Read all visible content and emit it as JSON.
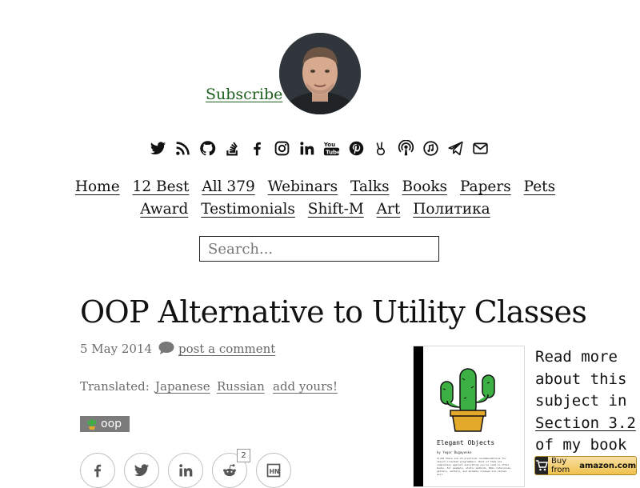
{
  "header": {
    "subscribe_label": "Subscribe"
  },
  "social_icons": [
    "twitter-icon",
    "rss-icon",
    "github-icon",
    "stackoverflow-icon",
    "facebook-icon",
    "instagram-icon",
    "linkedin-icon",
    "youtube-icon",
    "pinterest-icon",
    "peace-icon",
    "podcast-icon",
    "music-icon",
    "telegram-icon",
    "email-icon"
  ],
  "nav": {
    "row1": [
      "Home",
      "12 Best",
      "All 379",
      "Webinars",
      "Talks",
      "Books",
      "Papers",
      "Pets"
    ],
    "row2": [
      "Award",
      "Testimonials",
      "Shift-M",
      "Art",
      "Политика"
    ]
  },
  "search": {
    "placeholder": "Search..."
  },
  "post": {
    "title": "OOP Alternative to Utility Classes",
    "date": "5 May 2014",
    "comment_label": "post a comment",
    "translated_label": "Translated:",
    "translations": [
      "Japanese",
      "Russian",
      "add yours!"
    ],
    "tag": "oop",
    "share": [
      "facebook",
      "twitter",
      "linkedin",
      "reddit",
      "hackernews"
    ],
    "reddit_count": "2"
  },
  "book": {
    "title": "Elegant Objects",
    "author": "by Yegor Bugayenko",
    "blurb": "TL;DR There are 23 practical recommendations for object-oriented programmers. Most of them are completely against everything you've read in other books. For example, static methods, NULL references, getters, setters, and mutable classes are called evil.",
    "read_more_lines": [
      "Read more",
      "about this",
      "subject in"
    ],
    "section_link": "Section 3.2",
    "last_line": "of my book",
    "amazon_prefix": "Buy from",
    "amazon_brand": "amazon.com"
  },
  "colors": {
    "subscribe": "#1d5f1d",
    "tag_bg": "#7b7b7b",
    "cactus_green": "#3cb043",
    "pot": "#e3a92a"
  }
}
